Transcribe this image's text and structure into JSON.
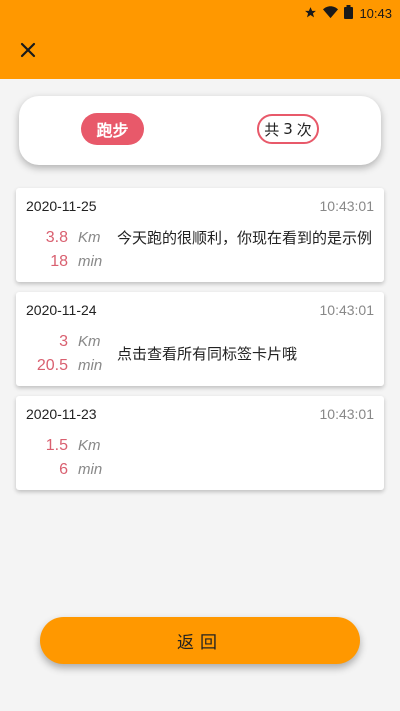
{
  "status_bar": {
    "time": "10:43",
    "icons": [
      "star-icon",
      "wifi-icon",
      "battery-icon"
    ]
  },
  "header": {
    "close_icon": "close-icon",
    "background_color": "#ff9800"
  },
  "summary": {
    "activity_type": "跑步",
    "count_prefix": "共",
    "count_value": "3",
    "count_suffix": "次",
    "accent_color": "#e8596a"
  },
  "records": [
    {
      "date": "2020-11-25",
      "time": "10:43:01",
      "distance": "3.8",
      "distance_unit": "Km",
      "duration": "18",
      "duration_unit": "min",
      "note": "今天跑的很顺利，你现在看到的是示例"
    },
    {
      "date": "2020-11-24",
      "time": "10:43:01",
      "distance": "3",
      "distance_unit": "Km",
      "duration": "20.5",
      "duration_unit": "min",
      "note": "点击查看所有同标签卡片哦"
    },
    {
      "date": "2020-11-23",
      "time": "10:43:01",
      "distance": "1.5",
      "distance_unit": "Km",
      "duration": "6",
      "duration_unit": "min",
      "note": ""
    }
  ],
  "footer": {
    "back_label": "返回"
  }
}
